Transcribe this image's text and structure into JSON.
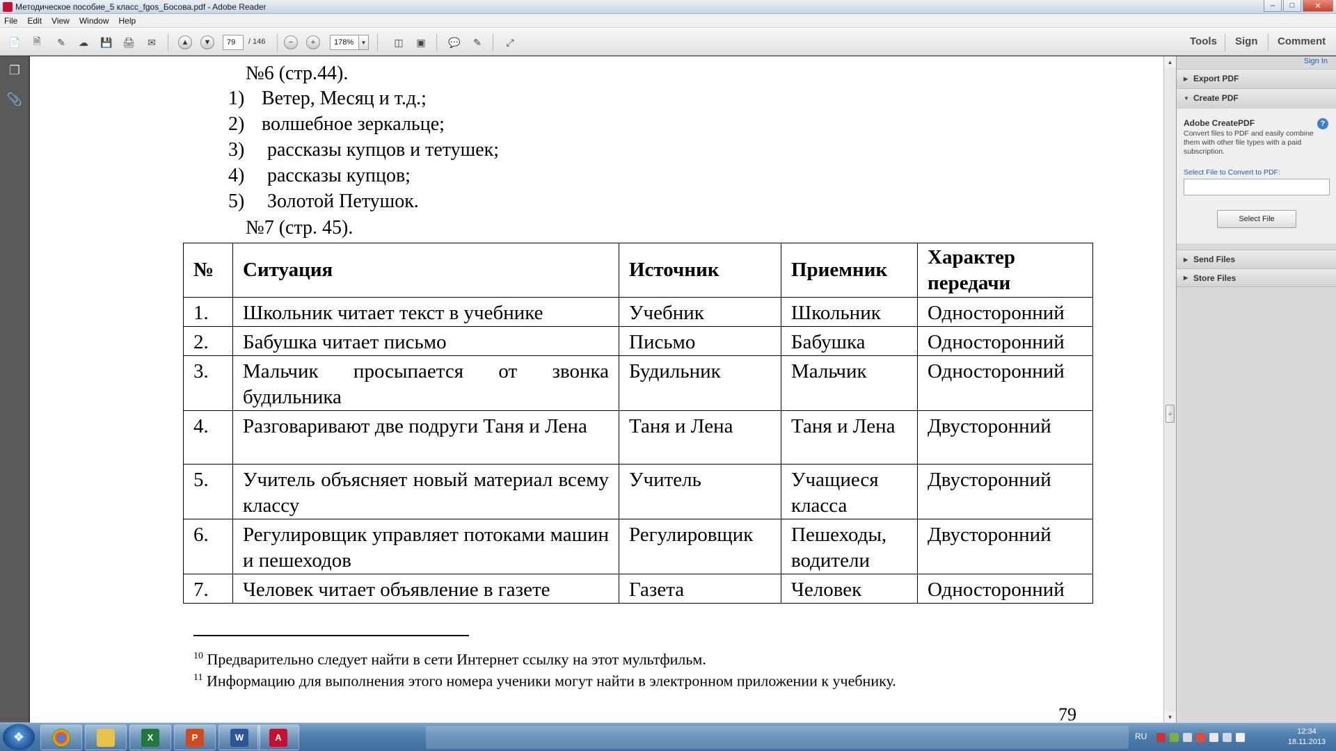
{
  "window": {
    "title": "Методическое пособие_5 класс_fgos_Босова.pdf - Adobe Reader"
  },
  "menu": [
    "File",
    "Edit",
    "View",
    "Window",
    "Help"
  ],
  "toolbar": {
    "page_current": "79",
    "page_total": "/ 146",
    "zoom": "178%",
    "links": {
      "tools": "Tools",
      "sign": "Sign",
      "comment": "Comment"
    }
  },
  "document": {
    "heading_top": "№6 (стр.44).",
    "list": [
      {
        "num": "1)",
        "text": "Ветер, Месяц и т.д.;"
      },
      {
        "num": "2)",
        "text": "волшебное зеркальце;"
      },
      {
        "num": "3)",
        "text": "рассказы купцов и тетушек;"
      },
      {
        "num": "4)",
        "text": "рассказы купцов;"
      },
      {
        "num": "5)",
        "text": "Золотой Петушок."
      }
    ],
    "heading_table": "№7 (стр. 45).",
    "table": {
      "headers": [
        "№",
        "Ситуация",
        "Источник",
        "Приемник",
        "Характер передачи"
      ],
      "rows": [
        [
          "1.",
          "Школьник читает текст в учебнике",
          "Учебник",
          "Школьник",
          "Односторонний"
        ],
        [
          "2.",
          "Бабушка читает письмо",
          "Письмо",
          "Бабушка",
          "Односторонний"
        ],
        [
          "3.",
          "Мальчик просыпается от звонка будильника",
          "Будильник",
          "Мальчик",
          "Односторонний"
        ],
        [
          "4.",
          "Разговаривают две подруги Таня и Лена",
          "Таня и Лена",
          "Таня и Лена",
          "Двусторонний"
        ],
        [
          "5.",
          "Учитель объясняет новый материал всему классу",
          "Учитель",
          "Учащиеся класса",
          "Двусторонний"
        ],
        [
          "6.",
          "Регулировщик управляет потоками машин и пешеходов",
          "Регулировщик",
          "Пешеходы, водители",
          "Двусторонний"
        ],
        [
          "7.",
          "Человек читает объявление в газете",
          "Газета",
          "Человек",
          "Односторонний"
        ]
      ]
    },
    "footnotes": [
      {
        "num": "10",
        "text": "Предварительно следует найти в сети Интернет ссылку на этот мультфильм."
      },
      {
        "num": "11",
        "text": "Информацию для выполнения этого номера ученики могут найти в электронном приложении к  учебнику."
      }
    ],
    "page_number": "79"
  },
  "right_pane": {
    "sign_in": "Sign In",
    "sections": [
      "Export PDF",
      "Create PDF",
      "Send Files",
      "Store Files"
    ],
    "create_pdf": {
      "title": "Adobe CreatePDF",
      "description": "Convert files to PDF and easily combine them with other file types with a paid subscription.",
      "select_label": "Select File to Convert to PDF:",
      "select_button": "Select File"
    }
  },
  "taskbar": {
    "lang": "RU",
    "time": "12:34",
    "date": "18.11.2013"
  }
}
